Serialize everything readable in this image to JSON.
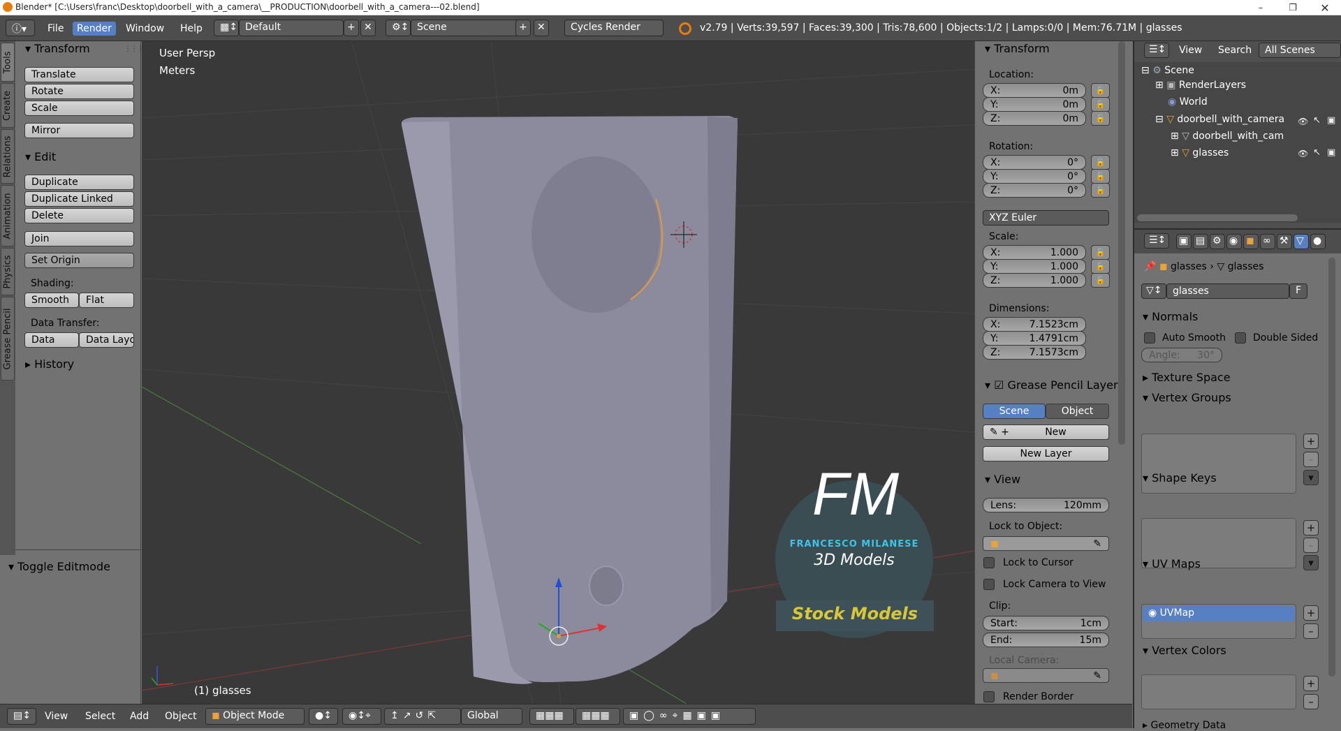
{
  "window": {
    "title": "Blender* [C:\\Users\\franc\\Desktop\\doorbell_with_a_camera\\__PRODUCTION\\doorbell_with_a_camera---02.blend]"
  },
  "menu": {
    "file": "File",
    "render": "Render",
    "window": "Window",
    "help": "Help"
  },
  "screen_layout": "Default",
  "scene_name": "Scene",
  "engine": "Cycles Render",
  "stats": "v2.79 | Verts:39,597 | Faces:39,300 | Tris:78,600 | Objects:1/2 | Lamps:0/0 | Mem:76.71M | glasses",
  "side_tabs": [
    "Tools",
    "Create",
    "Relations",
    "Animation",
    "Physics",
    "Grease Pencil"
  ],
  "tools": {
    "transform_header": "Transform",
    "translate": "Translate",
    "rotate": "Rotate",
    "scale": "Scale",
    "mirror": "Mirror",
    "edit_header": "Edit",
    "duplicate": "Duplicate",
    "duplicate_linked": "Duplicate Linked",
    "delete": "Delete",
    "join": "Join",
    "set_origin": "Set Origin",
    "shading_label": "Shading:",
    "smooth": "Smooth",
    "flat": "Flat",
    "data_transfer_label": "Data Transfer:",
    "data": "Data",
    "data_layout": "Data Layo",
    "history_header": "History",
    "toggle_editmode": "Toggle Editmode"
  },
  "viewport": {
    "persp": "User Persp",
    "units": "Meters",
    "object_label": "(1) glasses",
    "watermark": {
      "initials": "FM",
      "author": "FRANCESCO MILANESE",
      "sub": "3D Models",
      "banner": "Stock Models"
    }
  },
  "properties": {
    "transform_header": "Transform",
    "location_label": "Location:",
    "location": [
      {
        "axis": "X:",
        "value": "0m"
      },
      {
        "axis": "Y:",
        "value": "0m"
      },
      {
        "axis": "Z:",
        "value": "0m"
      }
    ],
    "rotation_label": "Rotation:",
    "rotation": [
      {
        "axis": "X:",
        "value": "0°"
      },
      {
        "axis": "Y:",
        "value": "0°"
      },
      {
        "axis": "Z:",
        "value": "0°"
      }
    ],
    "rotation_mode": "XYZ Euler",
    "scale_label": "Scale:",
    "scale": [
      {
        "axis": "X:",
        "value": "1.000"
      },
      {
        "axis": "Y:",
        "value": "1.000"
      },
      {
        "axis": "Z:",
        "value": "1.000"
      }
    ],
    "dimensions_label": "Dimensions:",
    "dimensions": [
      {
        "axis": "X:",
        "value": "7.1523cm"
      },
      {
        "axis": "Y:",
        "value": "1.4791cm"
      },
      {
        "axis": "Z:",
        "value": "7.1573cm"
      }
    ],
    "grease_header": "Grease Pencil Layer",
    "scene_btn": "Scene",
    "object_btn": "Object",
    "new_btn": "New",
    "new_layer": "New Layer",
    "view_header": "View",
    "lens_label": "Lens:",
    "lens_value": "120mm",
    "lock_to_object": "Lock to Object:",
    "lock_to_cursor": "Lock to Cursor",
    "lock_camera": "Lock Camera to View",
    "clip_label": "Clip:",
    "clip_start_label": "Start:",
    "clip_start": "1cm",
    "clip_end_label": "End:",
    "clip_end": "15m",
    "local_camera": "Local Camera:",
    "render_border": "Render Border"
  },
  "outliner": {
    "view": "View",
    "search": "Search",
    "filter": "All Scenes",
    "items": [
      "Scene",
      "RenderLayers",
      "World",
      "doorbell_with_camera",
      "doorbell_with_cam",
      "glasses"
    ]
  },
  "data_panel": {
    "breadcrumb_obj": "glasses",
    "breadcrumb_mesh": "glasses",
    "mesh_name": "glasses",
    "fake_user": "F",
    "normals": "Normals",
    "auto_smooth": "Auto Smooth",
    "double_sided": "Double Sided",
    "angle": "Angle:",
    "angle_value": "30°",
    "texture_space": "Texture Space",
    "vertex_groups": "Vertex Groups",
    "shape_keys": "Shape Keys",
    "uv_maps": "UV Maps",
    "uv_map_name": "UVMap",
    "vertex_colors": "Vertex Colors",
    "geometry_data": "Geometry Data"
  },
  "bottombar": {
    "view": "View",
    "select": "Select",
    "add": "Add",
    "object": "Object",
    "mode": "Object Mode",
    "orientation": "Global"
  }
}
